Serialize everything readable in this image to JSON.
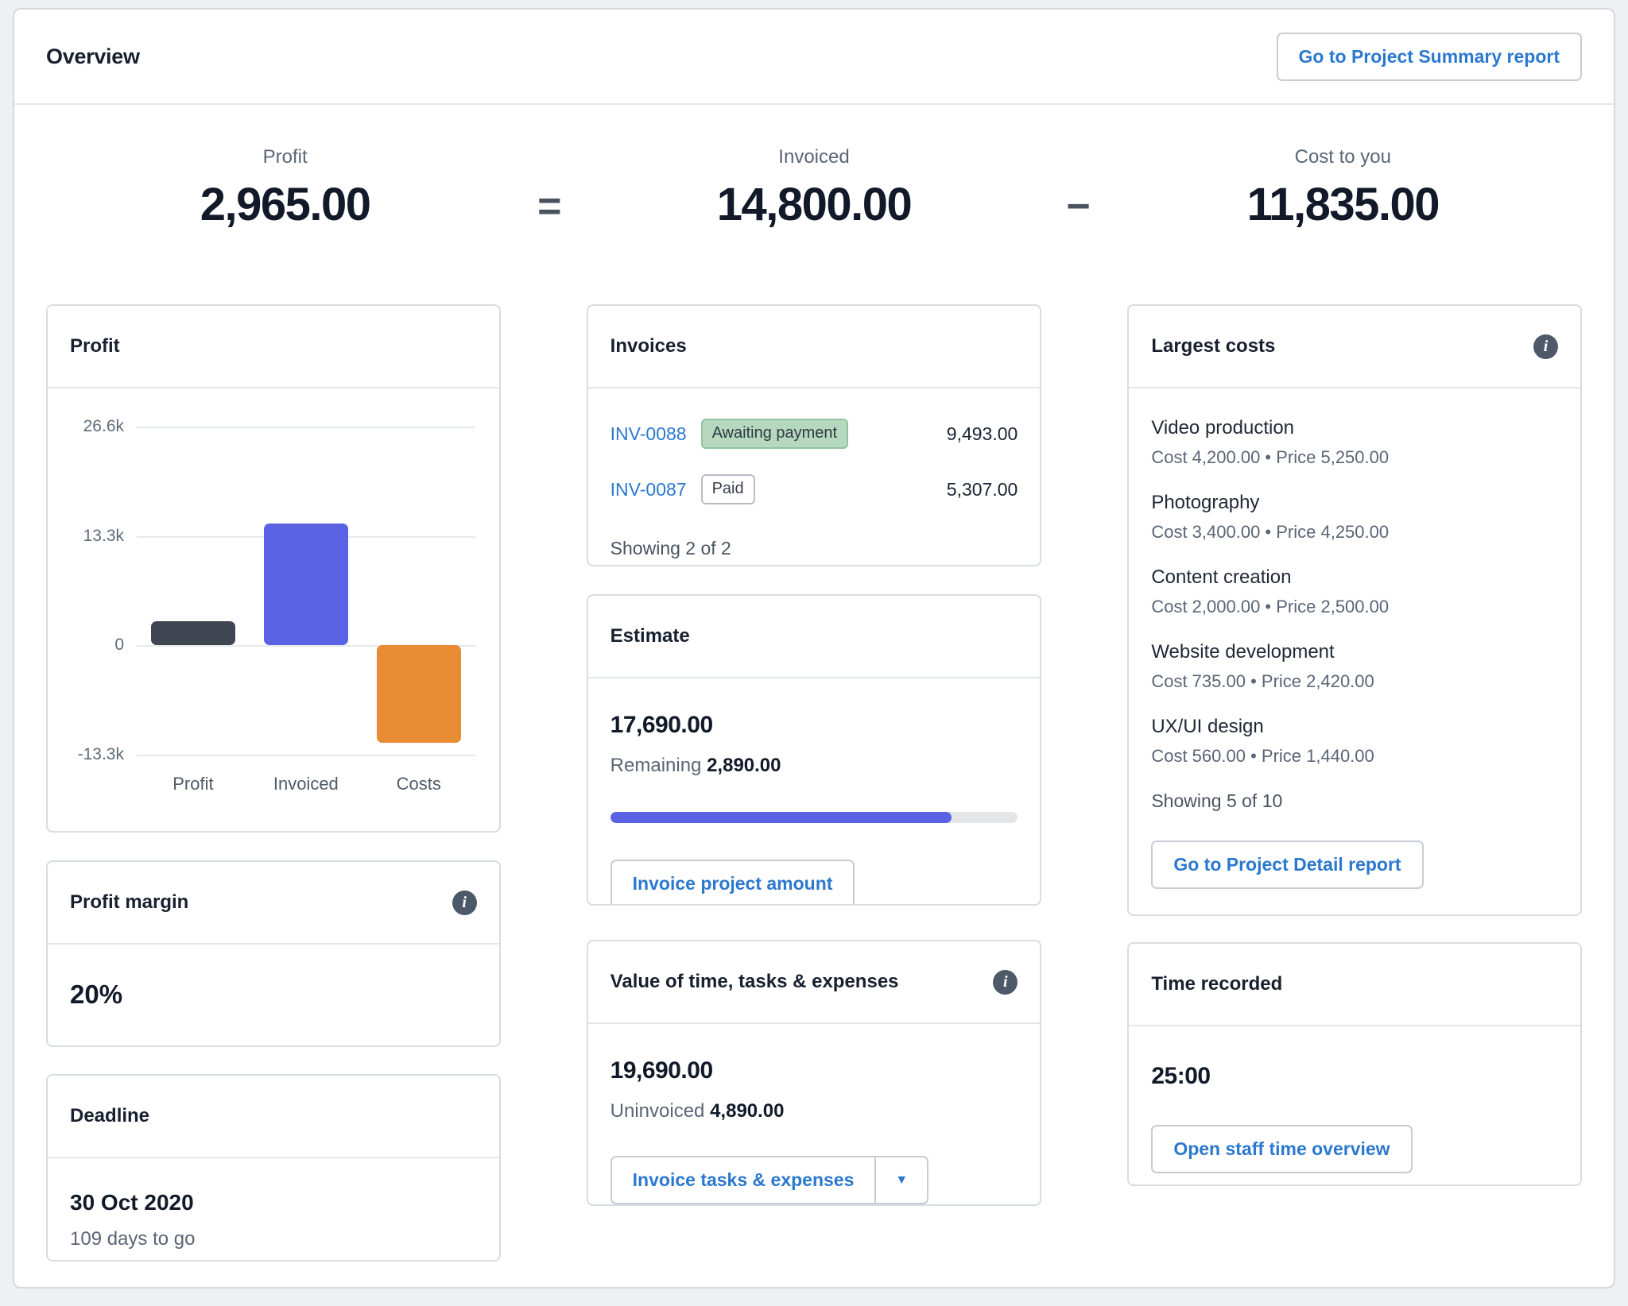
{
  "header": {
    "title": "Overview",
    "summary_button": "Go to Project Summary report"
  },
  "summary": {
    "items": [
      {
        "label": "Profit",
        "value": "2,965.00"
      },
      {
        "label": "Invoiced",
        "value": "14,800.00"
      },
      {
        "label": "Cost to you",
        "value": "11,835.00"
      }
    ],
    "operators": [
      "=",
      "−"
    ]
  },
  "profit_card": {
    "title": "Profit"
  },
  "chart_data": {
    "type": "bar",
    "title": "Profit",
    "categories": [
      "Profit",
      "Invoiced",
      "Costs"
    ],
    "values": [
      2965,
      14800,
      -11835
    ],
    "bar_colors": [
      "#3f4551",
      "#5b63e5",
      "#e88c33"
    ],
    "ytick_labels": [
      "26.6k",
      "13.3k",
      "0",
      "-13.3k"
    ],
    "ytick_values": [
      26600,
      13300,
      0,
      -13300
    ],
    "ylim": [
      -13300,
      26600
    ],
    "xlabel": "",
    "ylabel": "",
    "grid": true,
    "legend": "none"
  },
  "profit_margin_card": {
    "title": "Profit margin",
    "value": "20%"
  },
  "deadline_card": {
    "title": "Deadline",
    "date": "30 Oct 2020",
    "days_to_go": "109 days to go"
  },
  "invoices_card": {
    "title": "Invoices",
    "rows": [
      {
        "id": "INV-0088",
        "status": "Awaiting payment",
        "amount": "9,493.00"
      },
      {
        "id": "INV-0087",
        "status": "Paid",
        "amount": "5,307.00"
      }
    ],
    "showing": "Showing 2 of 2"
  },
  "estimate_card": {
    "title": "Estimate",
    "value": "17,690.00",
    "remaining_label": "Remaining",
    "remaining_value": "2,890.00",
    "progress_percent": 83.7,
    "button": "Invoice project amount"
  },
  "value_card": {
    "title": "Value of time, tasks & expenses",
    "value": "19,690.00",
    "uninvoiced_label": "Uninvoiced",
    "uninvoiced_value": "4,890.00",
    "button": "Invoice tasks & expenses"
  },
  "largest_costs_card": {
    "title": "Largest costs",
    "items": [
      {
        "name": "Video production",
        "detail": "Cost 4,200.00 • Price 5,250.00"
      },
      {
        "name": "Photography",
        "detail": "Cost 3,400.00 • Price 4,250.00"
      },
      {
        "name": "Content creation",
        "detail": "Cost 2,000.00 • Price 2,500.00"
      },
      {
        "name": "Website development",
        "detail": "Cost 735.00 • Price 2,420.00"
      },
      {
        "name": "UX/UI design",
        "detail": "Cost 560.00 • Price 1,440.00"
      }
    ],
    "showing": "Showing 5 of 10",
    "button": "Go to Project Detail report"
  },
  "time_card": {
    "title": "Time recorded",
    "value": "25:00",
    "button": "Open staff time overview"
  },
  "icons": {
    "info": "i",
    "caret_down": "▼"
  },
  "colors": {
    "accent_blue": "#2b78cf",
    "purple": "#5b63e5",
    "dark_bar": "#3f4551",
    "orange": "#e88c33",
    "badge_green_bg": "#b5d8bf",
    "badge_green_border": "#8fc3a0",
    "page_background": "#eef0f2",
    "text_dark": "#121a29",
    "text_gray": "#5a6575"
  }
}
